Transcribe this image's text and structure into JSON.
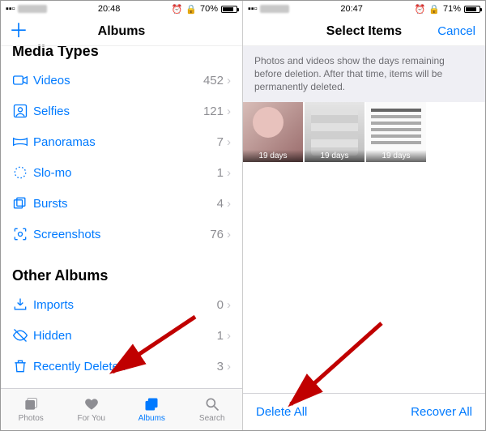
{
  "left": {
    "status": {
      "time": "20:48",
      "battery_pct": "70%",
      "battery_fill": "70%",
      "alarm": "⏰"
    },
    "nav": {
      "title": "Albums",
      "add": "＋"
    },
    "section1": "Media Types",
    "rows1": [
      {
        "label": "Videos",
        "count": "452"
      },
      {
        "label": "Selfies",
        "count": "121"
      },
      {
        "label": "Panoramas",
        "count": "7"
      },
      {
        "label": "Slo-mo",
        "count": "1"
      },
      {
        "label": "Bursts",
        "count": "4"
      },
      {
        "label": "Screenshots",
        "count": "76"
      }
    ],
    "section2": "Other Albums",
    "rows2": [
      {
        "label": "Imports",
        "count": "0"
      },
      {
        "label": "Hidden",
        "count": "1"
      },
      {
        "label": "Recently Deleted",
        "count": "3"
      }
    ],
    "tabs": [
      {
        "label": "Photos"
      },
      {
        "label": "For You"
      },
      {
        "label": "Albums"
      },
      {
        "label": "Search"
      }
    ]
  },
  "right": {
    "status": {
      "time": "20:47",
      "battery_pct": "71%",
      "battery_fill": "71%",
      "alarm": "⏰"
    },
    "nav": {
      "title": "Select Items",
      "cancel": "Cancel"
    },
    "notice": "Photos and videos show the days remaining before deletion. After that time, items will be permanently deleted.",
    "thumbs": [
      {
        "days": "19 days"
      },
      {
        "days": "19 days"
      },
      {
        "days": "19 days"
      }
    ],
    "actions": {
      "delete_all": "Delete All",
      "recover_all": "Recover All"
    }
  }
}
